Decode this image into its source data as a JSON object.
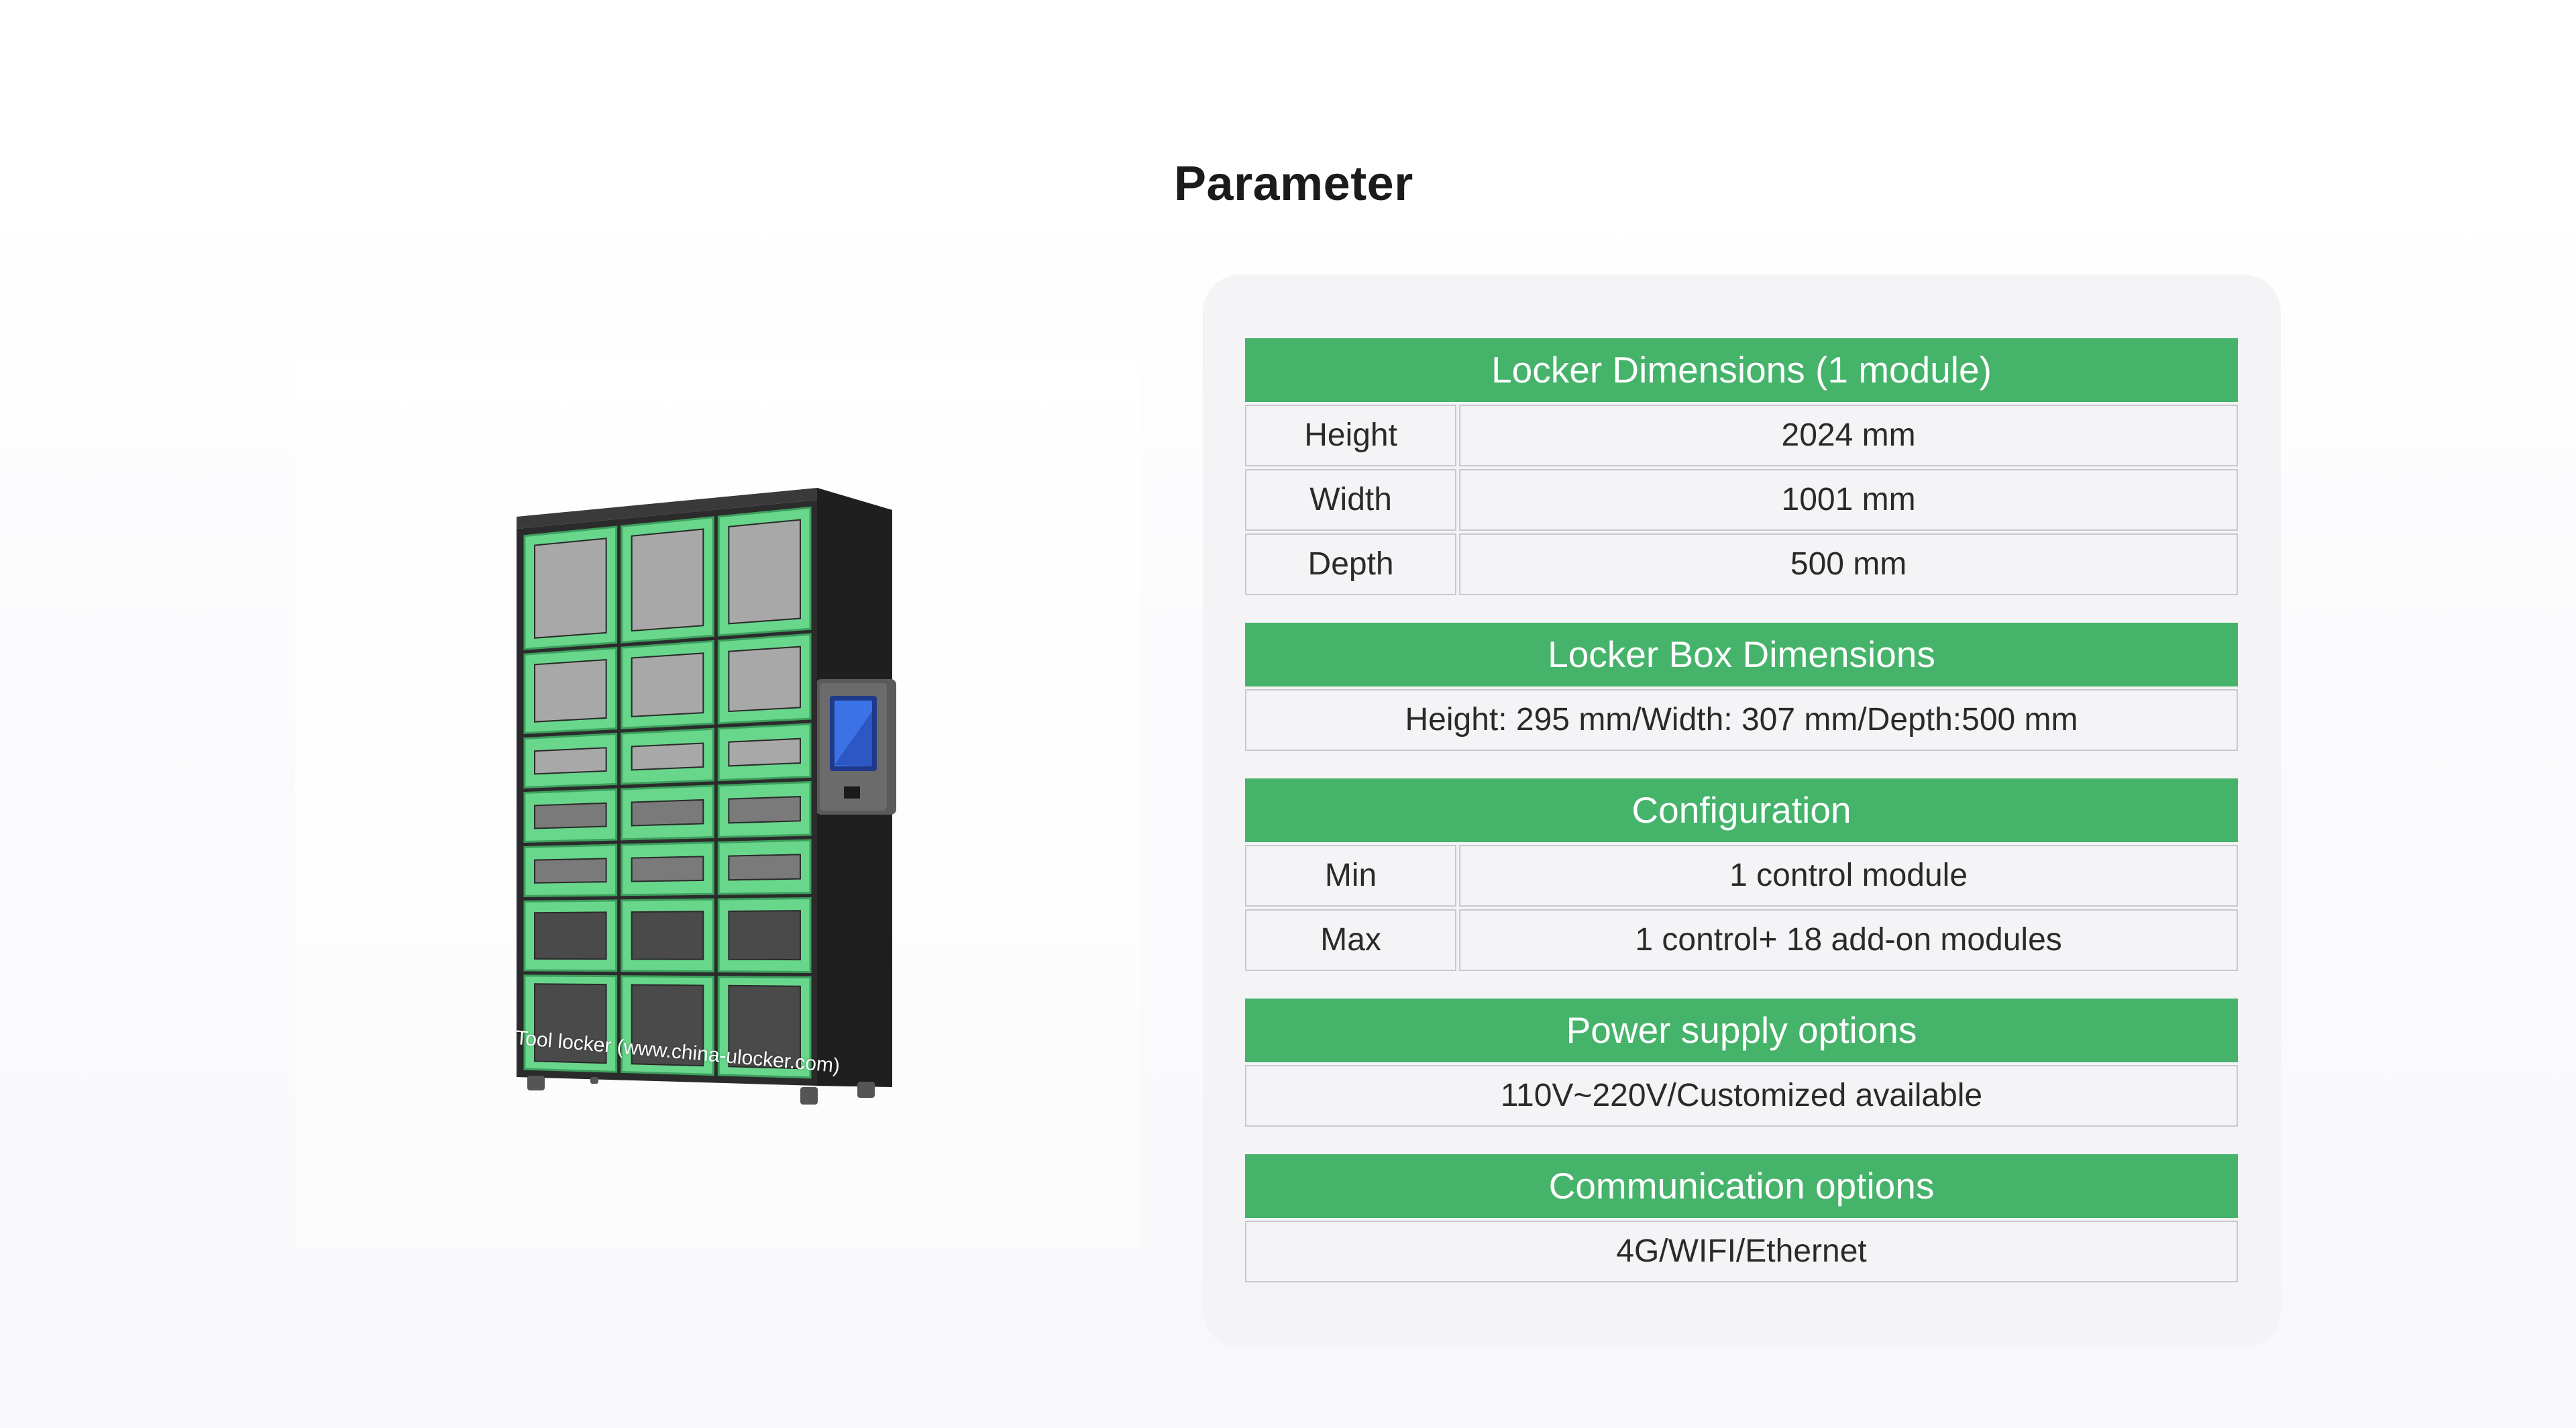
{
  "page": {
    "title": "Parameter"
  },
  "image": {
    "caption": "Tool locker (www.china-ulocker.com)",
    "colors": {
      "door_green": "#68d68b",
      "body_dark": "#2b2b2b",
      "window_grey": "#a8a8a8"
    }
  },
  "spec_table": {
    "locker_dimensions": {
      "header": "Locker Dimensions (1 module)",
      "rows": [
        {
          "label": "Height",
          "value": "2024 mm"
        },
        {
          "label": "Width",
          "value": "1001 mm"
        },
        {
          "label": "Depth",
          "value": "500 mm"
        }
      ]
    },
    "box_dimensions": {
      "header": "Locker Box Dimensions",
      "value": "Height: 295 mm/Width: 307 mm/Depth:500 mm"
    },
    "configuration": {
      "header": "Configuration",
      "rows": [
        {
          "label": "Min",
          "value": "1 control module"
        },
        {
          "label": "Max",
          "value": "1 control+ 18 add-on modules"
        }
      ]
    },
    "power_supply": {
      "header": "Power supply options",
      "value": "110V~220V/Customized available"
    },
    "communication": {
      "header": "Communication options",
      "value": "4G/WIFI/Ethernet"
    }
  },
  "colors": {
    "header_green": "#45b36a",
    "card_background": "#f4f4f6",
    "cell_border": "#c9c9cc"
  }
}
